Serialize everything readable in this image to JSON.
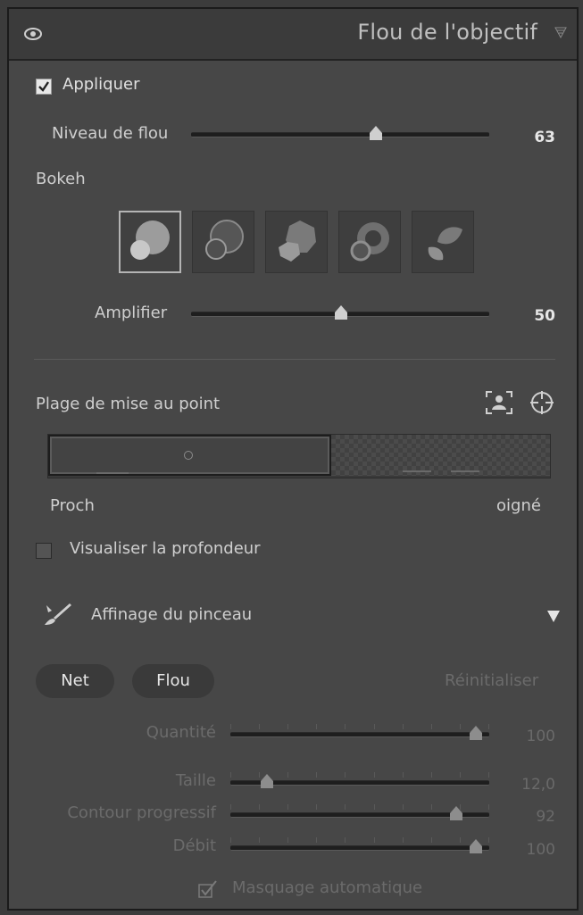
{
  "panel": {
    "title": "Flou de l'objectif",
    "icons": {
      "visibility": "eye-icon",
      "collapse": "triangle-down-icon"
    }
  },
  "apply": {
    "label": "Appliquer",
    "checked": true
  },
  "blur_amount": {
    "label": "Niveau de flou",
    "value": "63",
    "level": 63
  },
  "bokeh": {
    "label": "Bokeh",
    "options": [
      "bokeh-circle",
      "bokeh-bubble",
      "bokeh-blade",
      "bokeh-ring",
      "bokeh-cat-eye"
    ],
    "selected_index": 0
  },
  "boost": {
    "label": "Amplifier",
    "value": "50",
    "level": 50
  },
  "focal_range": {
    "label": "Plage de mise au point",
    "near_label": "Proch",
    "far_label": "oigné",
    "icons": [
      "subject-focus-icon",
      "point-focus-icon"
    ]
  },
  "visualize_depth": {
    "label": "Visualiser la profondeur",
    "checked": false
  },
  "brush_refine": {
    "label": "Affinage du pinceau",
    "icon": "brush-icon"
  },
  "brush_modes": {
    "sharp": "Net",
    "blur": "Flou",
    "reset": "Réinitialiser"
  },
  "brush_sliders": [
    {
      "label": "Quantité",
      "value": "100",
      "level": 100
    },
    {
      "label": "Taille",
      "value": "12,0",
      "level": 14
    },
    {
      "label": "Contour progressif",
      "value": "92",
      "level": 92
    },
    {
      "label": "Débit",
      "value": "100",
      "level": 100
    }
  ],
  "auto_mask": {
    "label": "Masquage automatique",
    "checked": true
  },
  "colors": {
    "panel_bg": "#474747",
    "header_bg": "#3b3b3b",
    "text": "#d2d2d2",
    "disabled_text": "#6b6b6b"
  }
}
